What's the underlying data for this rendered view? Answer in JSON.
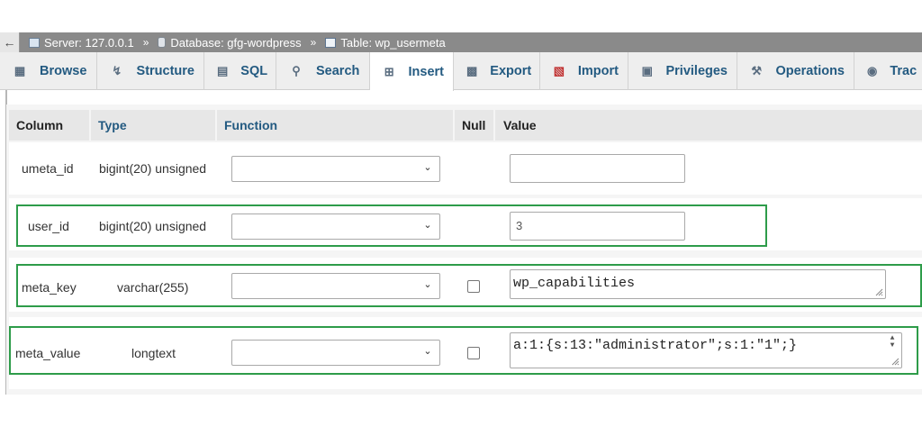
{
  "breadcrumb": {
    "back_icon": "arrow-left-icon",
    "server": "Server: 127.0.0.1",
    "database": "Database: gfg-wordpress",
    "table": "Table: wp_usermeta",
    "separator": "»"
  },
  "tabs": [
    {
      "label": "Browse",
      "icon": "browse-icon"
    },
    {
      "label": "Structure",
      "icon": "structure-icon"
    },
    {
      "label": "SQL",
      "icon": "sql-icon"
    },
    {
      "label": "Search",
      "icon": "search-icon"
    },
    {
      "label": "Insert",
      "icon": "insert-icon",
      "active": true
    },
    {
      "label": "Export",
      "icon": "export-icon"
    },
    {
      "label": "Import",
      "icon": "import-icon"
    },
    {
      "label": "Privileges",
      "icon": "privileges-icon"
    },
    {
      "label": "Operations",
      "icon": "operations-icon"
    },
    {
      "label": "Trac",
      "icon": "tracking-icon"
    }
  ],
  "headers": {
    "column": "Column",
    "type": "Type",
    "function": "Function",
    "null": "Null",
    "value": "Value"
  },
  "rows": [
    {
      "column": "umeta_id",
      "type": "bigint(20) unsigned",
      "function": "",
      "value": ""
    },
    {
      "column": "user_id",
      "type": "bigint(20) unsigned",
      "function": "",
      "value": "3"
    },
    {
      "column": "meta_key",
      "type": "varchar(255)",
      "function": "",
      "value": "wp_capabilities"
    },
    {
      "column": "meta_value",
      "type": "longtext",
      "function": "",
      "value": "a:1:{s:13:\"administrator\";s:1:\"1\";}"
    }
  ],
  "colors": {
    "highlight": "#2e9c4a",
    "link": "#235a81",
    "breadcrumb_bg": "#8a8a8a"
  }
}
